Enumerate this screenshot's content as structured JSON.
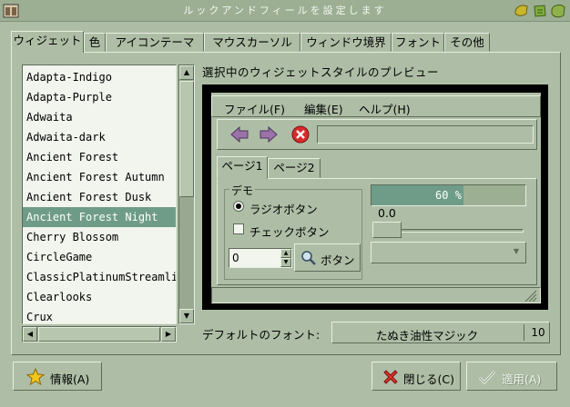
{
  "window": {
    "title": "ルックアンドフィールを設定します"
  },
  "tabs": [
    {
      "label": "ウィジェット",
      "active": true
    },
    {
      "label": "色",
      "active": false
    },
    {
      "label": "アイコンテーマ",
      "active": false
    },
    {
      "label": "マウスカーソル",
      "active": false
    },
    {
      "label": "ウィンドウ境界",
      "active": false
    },
    {
      "label": "フォント",
      "active": false
    },
    {
      "label": "その他",
      "active": false
    }
  ],
  "theme_list": {
    "items": [
      "Adapta-Indigo",
      "Adapta-Purple",
      "Adwaita",
      "Adwaita-dark",
      "Ancient Forest",
      "Ancient Forest Autumn",
      "Ancient Forest Dusk",
      "Ancient Forest Night",
      "Cherry Blossom",
      "CircleGame",
      "ClassicPlatinumStreamlined",
      "Clearlooks",
      "Crux"
    ],
    "selected_index": 7
  },
  "preview": {
    "title": "選択中のウィジェットスタイルのプレビュー",
    "menu": [
      "ファイル(F)",
      "編集(E)",
      "ヘルプ(H)"
    ],
    "tabs": [
      "ページ1",
      "ページ2"
    ],
    "demo_legend": "デモ",
    "radio_label": "ラジオボタン",
    "check_label": "チェックボタン",
    "spin_value": "0",
    "button_label": "ボタン",
    "progress": {
      "value": 0.6,
      "text": "60 %"
    },
    "scale_value": "0.0"
  },
  "font": {
    "label": "デフォルトのフォント:",
    "name": "たぬき油性マジック",
    "size": "10"
  },
  "buttons": {
    "about": "情報(A)",
    "close": "閉じる(C)",
    "apply": "適用(A)"
  },
  "colors": {
    "background": "#aebea6",
    "selection": "#6e9c88",
    "list_background": "#f2f4ee",
    "preview_frame": "#000000"
  }
}
